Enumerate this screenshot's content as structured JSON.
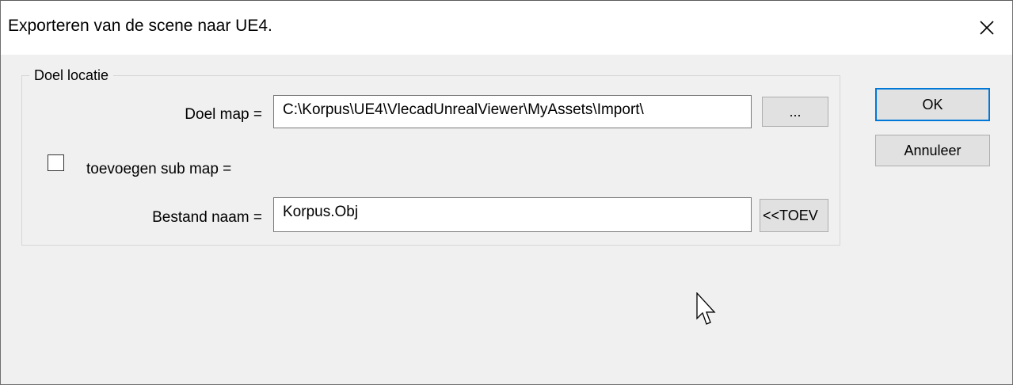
{
  "dialog": {
    "title": "Exporteren van de scene naar UE4.",
    "close_icon": "close-icon"
  },
  "group": {
    "legend": "Doel locatie",
    "target_folder_label": "Doel map =",
    "target_folder_value": "C:\\Korpus\\UE4\\VlecadUnrealViewer\\MyAssets\\Import\\",
    "browse_label": "...",
    "subfolder_label": "toevoegen sub map =",
    "subfolder_checked": false,
    "filename_label": "Bestand naam =",
    "filename_value": "Korpus.Obj",
    "add_label": "<<TOEV"
  },
  "buttons": {
    "ok": "OK",
    "cancel": "Annuleer"
  },
  "colors": {
    "accent": "#0078d7",
    "dialog_bg": "#f0f0f0",
    "button_bg": "#e1e1e1"
  }
}
